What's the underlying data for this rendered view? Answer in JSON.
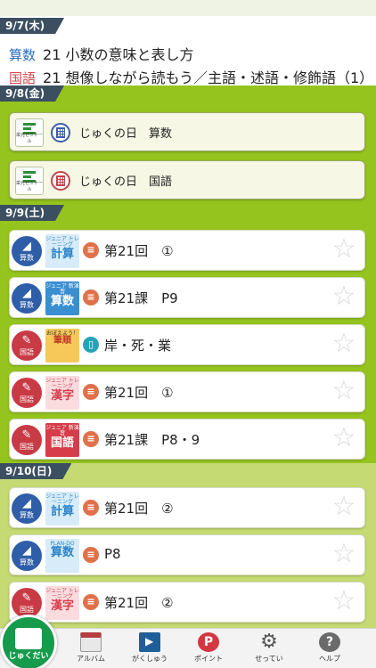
{
  "days": [
    {
      "date": "9/7(木)",
      "lessons": [
        {
          "subject": "算数",
          "subject_color": "#2f6cc0",
          "text": "21 小数の意味と表し方"
        },
        {
          "subject": "国語",
          "subject_color": "#d8454f",
          "text": "21 想像しながら読もう／主語・述語・修飾語（1）"
        }
      ]
    },
    {
      "date": "9/8(金)",
      "cards": [
        {
          "logo_text": "栄光ゼミナール",
          "label": "じゅくの日　算数",
          "icon": "calendar-blue-icon"
        },
        {
          "logo_text": "栄光ゼミナール",
          "label": "じゅくの日　国語",
          "icon": "calendar-red-icon"
        }
      ]
    },
    {
      "date": "9/9(土)",
      "tasks": [
        {
          "subject": "算数",
          "badge_glyph": "◢",
          "book_small": "ジュニア トレーニング",
          "book_big": "計算",
          "task_icon": "≡",
          "text": "第21回　①"
        },
        {
          "subject": "算数",
          "badge_glyph": "◢",
          "book_small": "ジュニア 新演習",
          "book_big": "算数",
          "task_icon": "≡",
          "text": "第21課　P9"
        },
        {
          "subject": "国語",
          "badge_glyph": "✎",
          "book_small": "おぼえよう！",
          "book_big": "筆順",
          "task_icon": "▯",
          "text": "岸・死・業"
        },
        {
          "subject": "国語",
          "badge_glyph": "✎",
          "book_small": "ジュニア トレーニング",
          "book_big": "漢字",
          "task_icon": "≡",
          "text": "第21回　①"
        },
        {
          "subject": "国語",
          "badge_glyph": "✎",
          "book_small": "ジュニア 新演習",
          "book_big": "国語",
          "task_icon": "≡",
          "text": "第21課　P8・9"
        }
      ]
    },
    {
      "date": "9/10(日)",
      "tasks": [
        {
          "subject": "算数",
          "badge_glyph": "◢",
          "book_small": "ジュニア トレーニング",
          "book_big": "計算",
          "task_icon": "≡",
          "text": "第21回　②"
        },
        {
          "subject": "算数",
          "badge_glyph": "◢",
          "book_small": "PLAN-DO",
          "book_big": "算数",
          "task_icon": "≡",
          "text": "P8"
        },
        {
          "subject": "国語",
          "badge_glyph": "✎",
          "book_small": "ジュニア トレーニング",
          "book_big": "漢字",
          "task_icon": "≡",
          "text": "第21回　②"
        }
      ]
    }
  ],
  "star": "☆",
  "nav": [
    {
      "label": "アルバム",
      "icon": "calendar-icon"
    },
    {
      "label": "がくしゅう",
      "icon": "film-icon"
    },
    {
      "label": "ポイント",
      "icon": "point-icon",
      "glyph": "P"
    },
    {
      "label": "せってい",
      "icon": "gear-icon",
      "glyph": "⚙"
    },
    {
      "label": "ヘルプ",
      "icon": "help-icon",
      "glyph": "?"
    }
  ],
  "fab": {
    "label": "じゅくだい"
  },
  "colors": {
    "band_green": "#95c41e",
    "band_lime": "#c6da73",
    "date_tab": "#3b4f61",
    "fab": "#169a4c"
  }
}
